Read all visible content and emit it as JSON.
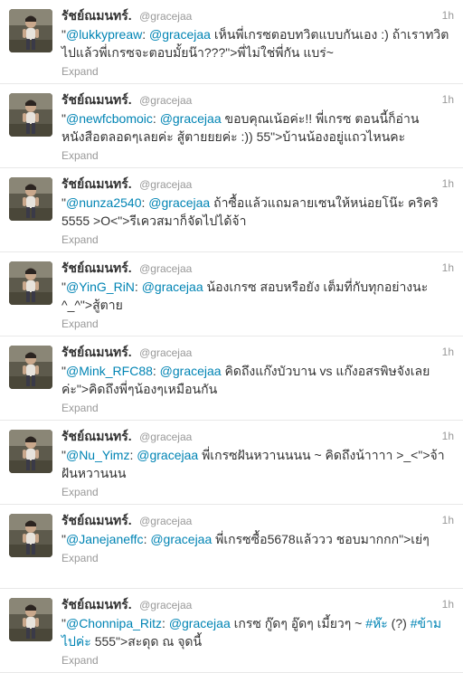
{
  "timeline": {
    "tweets": [
      {
        "fullname": "รัชย์ณมนทร์.",
        "username": "@gracejaa",
        "time": "1h",
        "segments": [
          {
            "text": "\"",
            "type": "text"
          },
          {
            "text": "@lukkypreaw",
            "type": "mention"
          },
          {
            "text": ": ",
            "type": "text"
          },
          {
            "text": "@gracejaa",
            "type": "mention"
          },
          {
            "text": " เห็นพี่เกรซตอบทวิตแบบกันเอง :) ถ้าเราทวิตไปแล้วพี่เกรซจะตอบมั้ยน๊า???\">พี่ไม่ใช่พี่กัน แบร่~",
            "type": "text"
          }
        ],
        "expand": "Expand"
      },
      {
        "fullname": "รัชย์ณมนทร์.",
        "username": "@gracejaa",
        "time": "1h",
        "segments": [
          {
            "text": "\"",
            "type": "text"
          },
          {
            "text": "@newfcbomoic",
            "type": "mention"
          },
          {
            "text": ": ",
            "type": "text"
          },
          {
            "text": "@gracejaa",
            "type": "mention"
          },
          {
            "text": " ขอบคุณเน้อค่ะ!! พี่เกรซ ตอนนี้ก็อ่านหนังสือตลอดๆเลยค่ะ สู้ตายยยค่ะ :)) 55\">บ้านน้องอยู่แถวไหนคะ",
            "type": "text"
          }
        ],
        "expand": "Expand"
      },
      {
        "fullname": "รัชย์ณมนทร์.",
        "username": "@gracejaa",
        "time": "1h",
        "segments": [
          {
            "text": "\"",
            "type": "text"
          },
          {
            "text": "@nunza2540",
            "type": "mention"
          },
          {
            "text": ": ",
            "type": "text"
          },
          {
            "text": "@gracejaa",
            "type": "mention"
          },
          {
            "text": " ถ้าซื้อแล้วแถมลายเซนให้หน่อยโน๊ะ คริคริ 5555 >O<\">รีเควสมาก็จัดไปได้จ้า",
            "type": "text"
          }
        ],
        "expand": "Expand"
      },
      {
        "fullname": "รัชย์ณมนทร์.",
        "username": "@gracejaa",
        "time": "1h",
        "segments": [
          {
            "text": "\"",
            "type": "text"
          },
          {
            "text": "@YinG_RiN",
            "type": "mention"
          },
          {
            "text": ": ",
            "type": "text"
          },
          {
            "text": "@gracejaa",
            "type": "mention"
          },
          {
            "text": " น้องเกรซ สอบหรือยัง เต็มที่กับทุกอย่างนะ ^_^\">สู้ตาย",
            "type": "text"
          }
        ],
        "expand": "Expand"
      },
      {
        "fullname": "รัชย์ณมนทร์.",
        "username": "@gracejaa",
        "time": "1h",
        "segments": [
          {
            "text": "\"",
            "type": "text"
          },
          {
            "text": "@Mink_RFC88",
            "type": "mention"
          },
          {
            "text": ": ",
            "type": "text"
          },
          {
            "text": "@gracejaa",
            "type": "mention"
          },
          {
            "text": " คิดถึงแก๊งบัวบาน vs แก๊งอสรพิษจังเลยค่ะ\">คิดถึงพี่ๆน้องๆเหมือนกัน",
            "type": "text"
          }
        ],
        "expand": "Expand"
      },
      {
        "fullname": "รัชย์ณมนทร์.",
        "username": "@gracejaa",
        "time": "1h",
        "segments": [
          {
            "text": "\"",
            "type": "text"
          },
          {
            "text": "@Nu_Yimz",
            "type": "mention"
          },
          {
            "text": ": ",
            "type": "text"
          },
          {
            "text": "@gracejaa",
            "type": "mention"
          },
          {
            "text": " พี่เกรซฝันหวานนนน ~ คิดถึงน้าาาา >_<\">จ้า ฝันหวานนน",
            "type": "text"
          }
        ],
        "expand": "Expand"
      },
      {
        "fullname": "รัชย์ณมนทร์.",
        "username": "@gracejaa",
        "time": "1h",
        "segments": [
          {
            "text": "\"",
            "type": "text"
          },
          {
            "text": "@Janejaneffc",
            "type": "mention"
          },
          {
            "text": ": ",
            "type": "text"
          },
          {
            "text": "@gracejaa",
            "type": "mention"
          },
          {
            "text": " พี่เกรซซื้อ5678แล้ววว ชอบมากกก\">เย่ๆ",
            "type": "text"
          }
        ],
        "expand": "Expand"
      },
      {
        "fullname": "รัชย์ณมนทร์.",
        "username": "@gracejaa",
        "time": "1h",
        "segments": [
          {
            "text": "\"",
            "type": "text"
          },
          {
            "text": "@Chonnipa_Ritz",
            "type": "mention"
          },
          {
            "text": ": ",
            "type": "text"
          },
          {
            "text": "@gracejaa",
            "type": "mention"
          },
          {
            "text": " เกรซ กู๊ดๆ อู๊ดๆ เมี้ยวๆ ~ ",
            "type": "text"
          },
          {
            "text": "#ห๊ะ",
            "type": "hashtag"
          },
          {
            "text": " (?) ",
            "type": "text"
          },
          {
            "text": "#ข้ามไปค่ะ",
            "type": "hashtag"
          },
          {
            "text": " 555\">สะดุด ณ จุดนี้",
            "type": "text"
          }
        ],
        "expand": "Expand"
      }
    ]
  },
  "colors": {
    "link": "#0084b4",
    "muted": "#999999",
    "text": "#333333",
    "divider": "#e8e8e8"
  }
}
